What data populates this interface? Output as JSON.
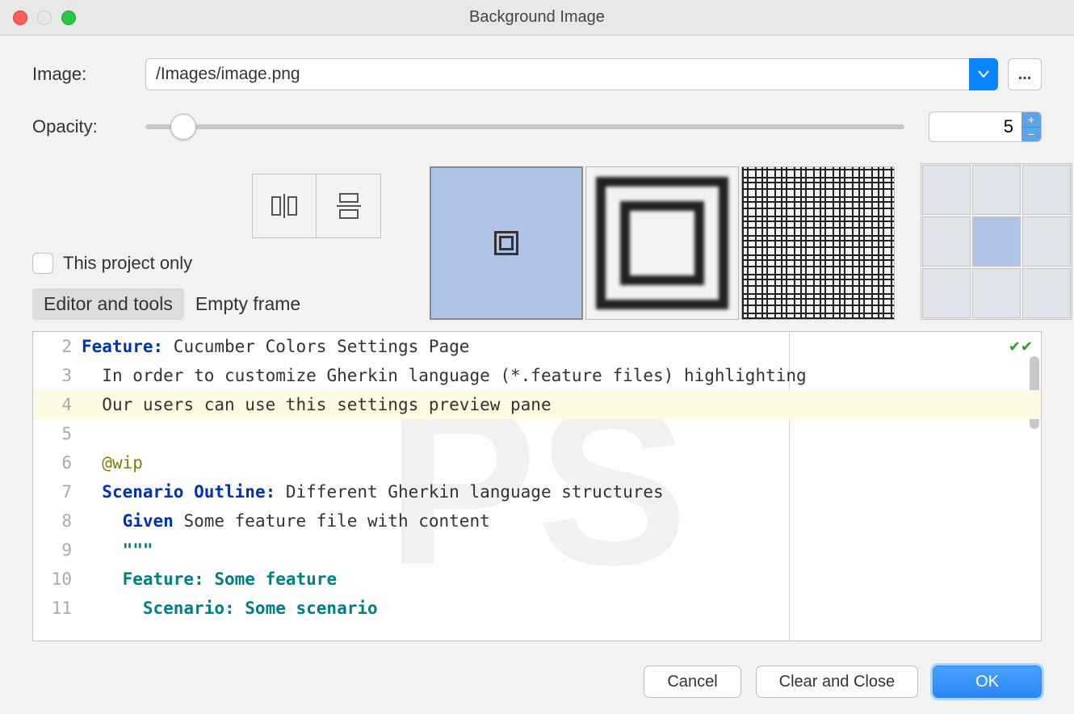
{
  "window": {
    "title": "Background Image"
  },
  "image": {
    "label": "Image:",
    "path": "/Images/image.png",
    "browse": "..."
  },
  "opacity": {
    "label": "Opacity:",
    "value": "5"
  },
  "checkbox": {
    "label": "This project only"
  },
  "tabs": {
    "editor": "Editor and tools",
    "empty": "Empty frame"
  },
  "editor": {
    "lines": [
      {
        "n": "2",
        "parts": [
          {
            "c": "kw",
            "t": "Feature:"
          },
          {
            "c": "",
            "t": " Cucumber Colors Settings Page"
          }
        ]
      },
      {
        "n": "3",
        "parts": [
          {
            "c": "dots",
            "t": "  "
          },
          {
            "c": "",
            "t": "In order to customize Gherkin language (*.feature files) highlighting"
          }
        ]
      },
      {
        "n": "4",
        "hl": true,
        "parts": [
          {
            "c": "dots",
            "t": "  "
          },
          {
            "c": "",
            "t": "Our users can use this settings preview pane"
          }
        ]
      },
      {
        "n": "5",
        "parts": []
      },
      {
        "n": "6",
        "parts": [
          {
            "c": "dots",
            "t": "  "
          },
          {
            "c": "tag-ann",
            "t": "@wip"
          }
        ]
      },
      {
        "n": "7",
        "parts": [
          {
            "c": "dots",
            "t": "  "
          },
          {
            "c": "kw",
            "t": "Scenario Outline:"
          },
          {
            "c": "",
            "t": " Different Gherkin language structures"
          }
        ]
      },
      {
        "n": "8",
        "parts": [
          {
            "c": "dots",
            "t": "    "
          },
          {
            "c": "kw",
            "t": "Given"
          },
          {
            "c": "",
            "t": " Some feature file with content"
          }
        ]
      },
      {
        "n": "9",
        "parts": [
          {
            "c": "dots",
            "t": "    "
          },
          {
            "c": "str",
            "t": "\"\"\""
          }
        ]
      },
      {
        "n": "10",
        "parts": [
          {
            "c": "dots",
            "t": "    "
          },
          {
            "c": "str",
            "t": "Feature: Some feature"
          }
        ]
      },
      {
        "n": "11",
        "parts": [
          {
            "c": "dots",
            "t": "      "
          },
          {
            "c": "str",
            "t": "Scenario: Some scenario"
          }
        ]
      }
    ]
  },
  "buttons": {
    "cancel": "Cancel",
    "clear": "Clear and Close",
    "ok": "OK"
  }
}
